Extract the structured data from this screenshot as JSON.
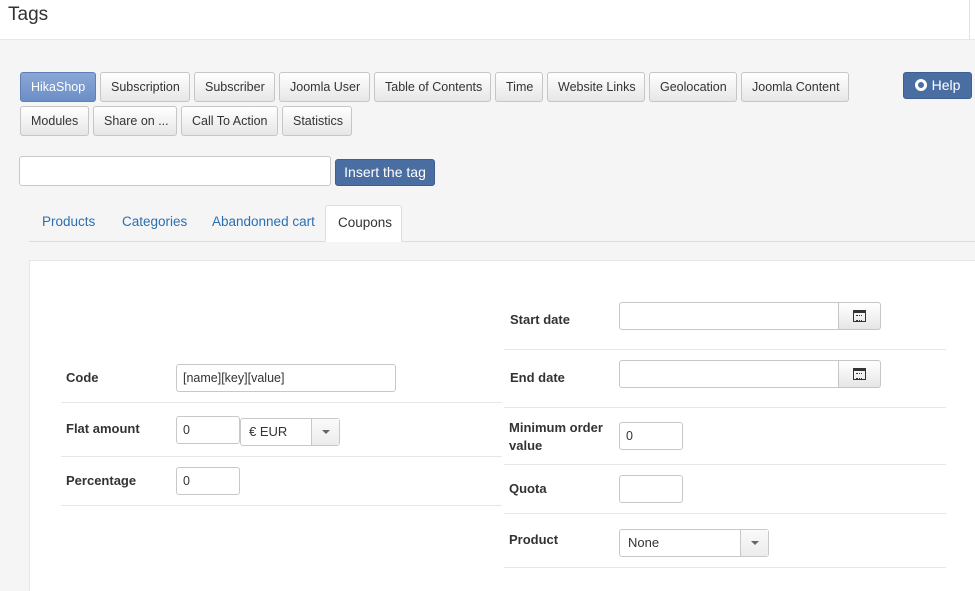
{
  "page": {
    "title": "Tags"
  },
  "tag_buttons": [
    {
      "label": "HikaShop",
      "active": true
    },
    {
      "label": "Subscription"
    },
    {
      "label": "Subscriber"
    },
    {
      "label": "Joomla User"
    },
    {
      "label": "Table of Contents"
    },
    {
      "label": "Time"
    },
    {
      "label": "Website Links"
    },
    {
      "label": "Geolocation"
    },
    {
      "label": "Joomla Content"
    },
    {
      "label": "Modules"
    },
    {
      "label": "Share on ..."
    },
    {
      "label": "Call To Action"
    },
    {
      "label": "Statistics"
    }
  ],
  "help": {
    "label": "Help"
  },
  "insert": {
    "input_value": "",
    "button_label": "Insert the tag"
  },
  "tabs": [
    {
      "label": "Products"
    },
    {
      "label": "Categories"
    },
    {
      "label": "Abandonned cart"
    },
    {
      "label": "Coupons",
      "active": true
    }
  ],
  "coupons": {
    "code": {
      "label": "Code",
      "value": "[name][key][value]"
    },
    "flat_amount": {
      "label": "Flat amount",
      "value": "0",
      "currency": "€ EUR"
    },
    "percentage": {
      "label": "Percentage",
      "value": "0"
    },
    "start_date": {
      "label": "Start date",
      "value": ""
    },
    "end_date": {
      "label": "End date",
      "value": ""
    },
    "minimum_order": {
      "label_line1": "Minimum order",
      "label_line2": "value",
      "value": "0"
    },
    "quota": {
      "label": "Quota",
      "value": ""
    },
    "product": {
      "label": "Product",
      "value": "None"
    }
  },
  "colors": {
    "accent": "#4a6ea2",
    "active_tag": "#7a9ace",
    "link": "#2a6fb1"
  },
  "icons": {
    "calendar": "calendar-icon",
    "help": "lifebuoy-icon",
    "dropdown": "chevron-down-icon"
  }
}
